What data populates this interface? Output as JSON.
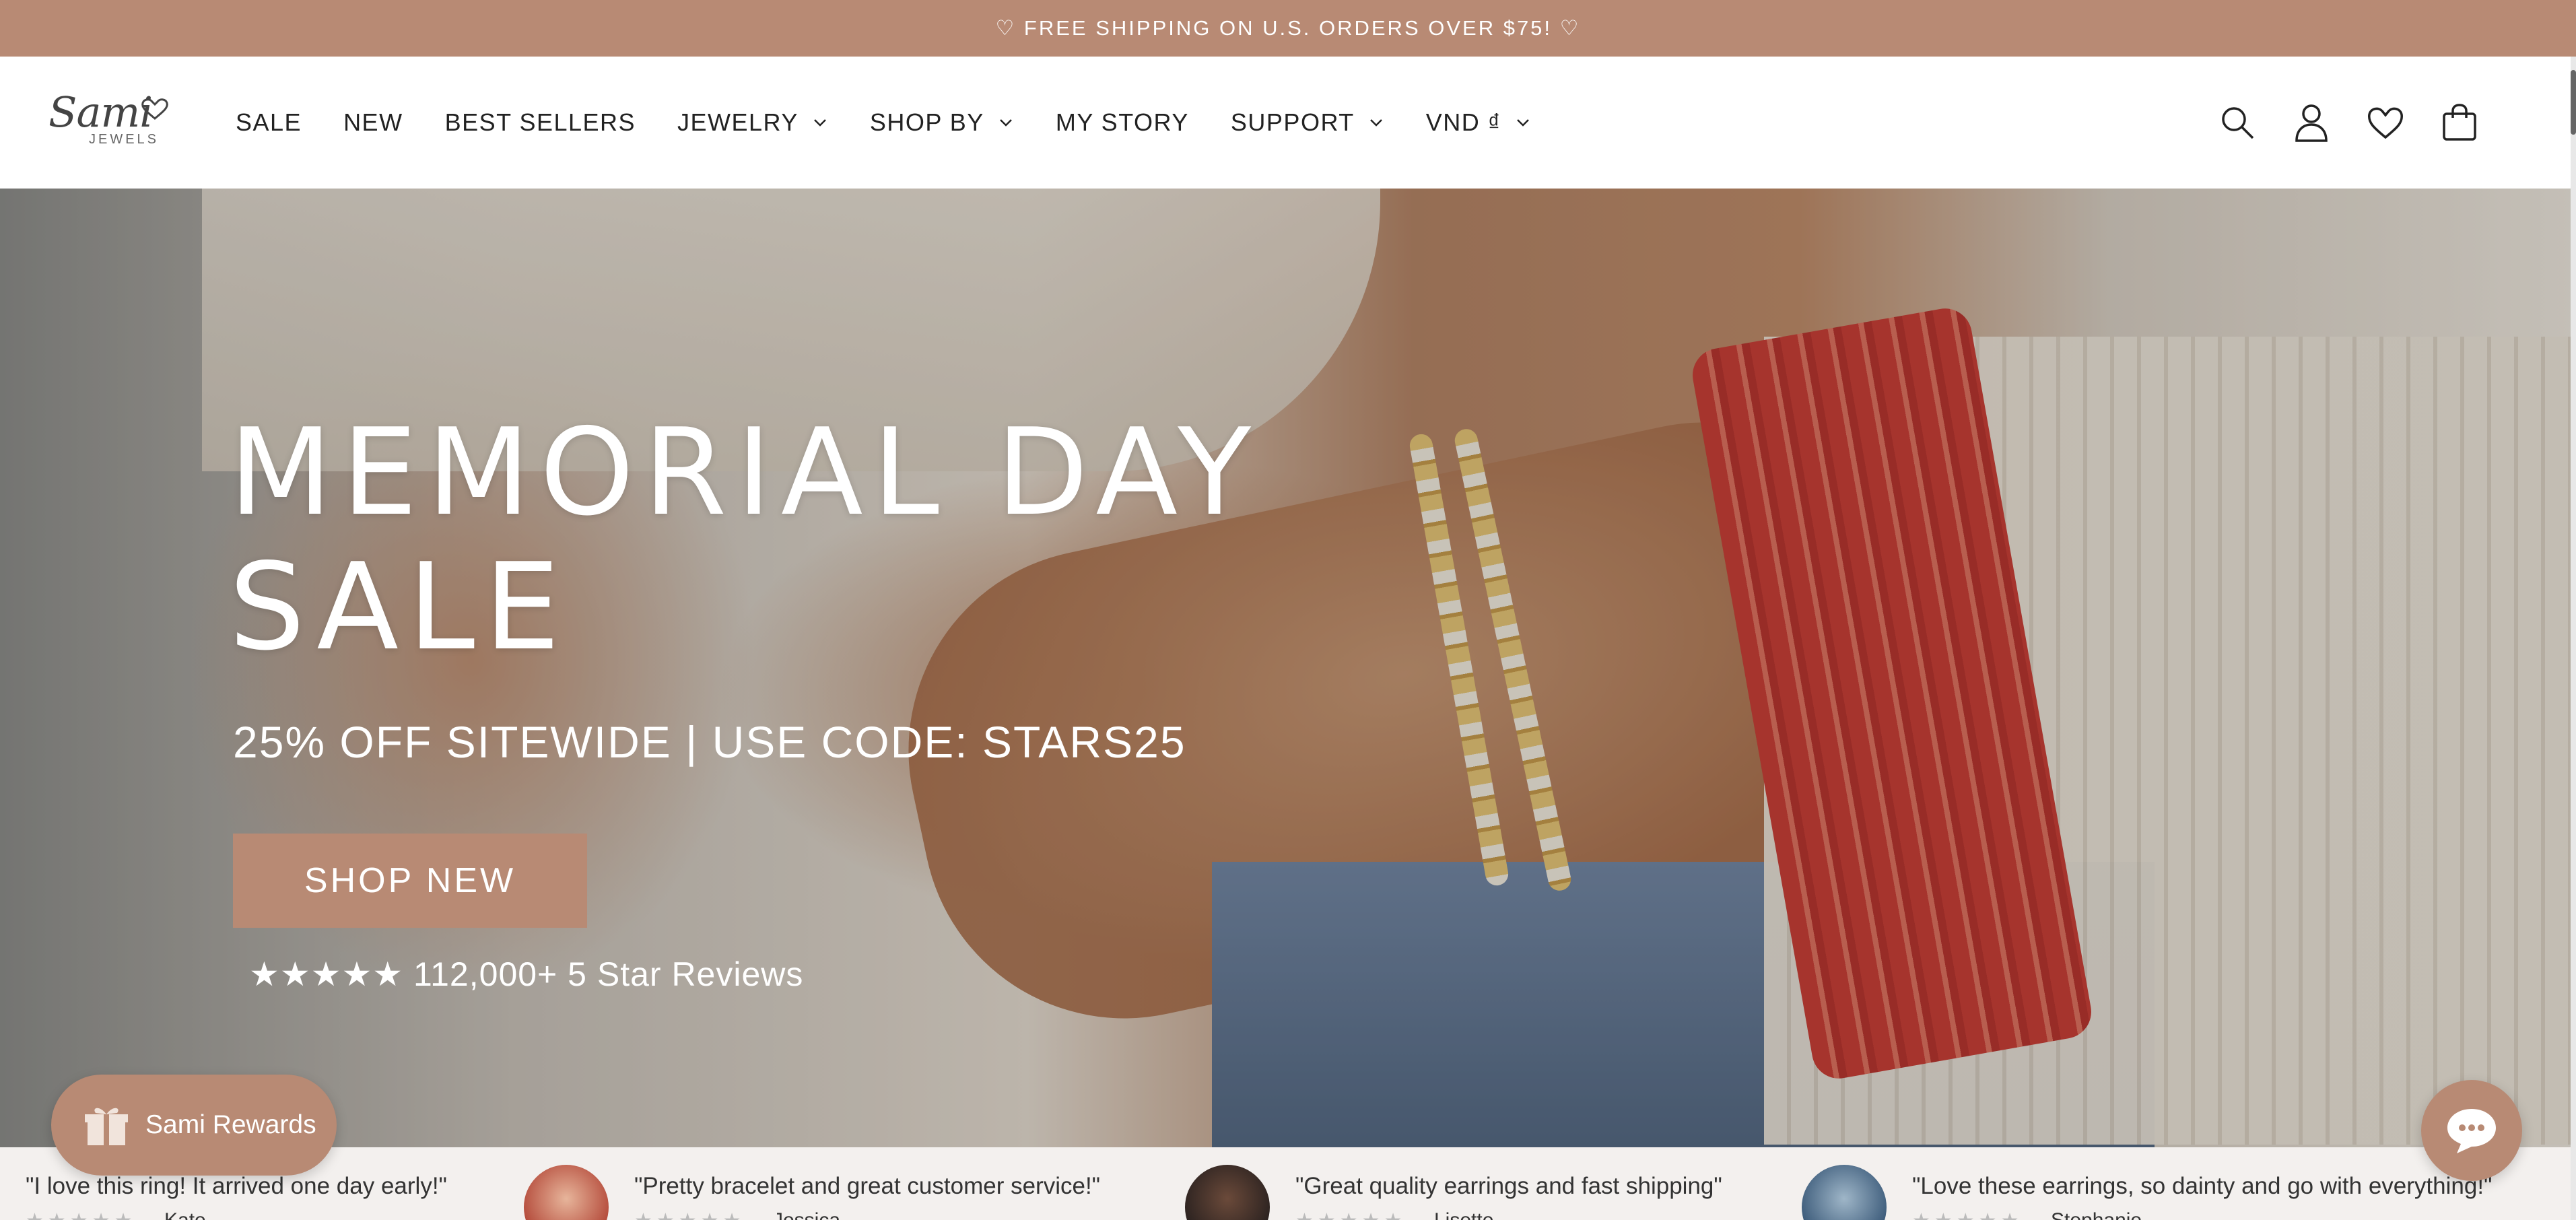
{
  "announcement": {
    "text": "♡ FREE SHIPPING ON U.S. ORDERS OVER $75! ♡"
  },
  "logo": {
    "script": "Sami",
    "sub": "JEWELS"
  },
  "nav": {
    "items": [
      {
        "label": "SALE",
        "dropdown": false
      },
      {
        "label": "NEW",
        "dropdown": false
      },
      {
        "label": "BEST SELLERS",
        "dropdown": false
      },
      {
        "label": "JEWELRY",
        "dropdown": true
      },
      {
        "label": "SHOP BY",
        "dropdown": true
      },
      {
        "label": "MY STORY",
        "dropdown": false
      },
      {
        "label": "SUPPORT",
        "dropdown": true
      },
      {
        "label": "VND ₫",
        "dropdown": true
      }
    ]
  },
  "header_icons": [
    "search-icon",
    "account-icon",
    "wishlist-heart-icon",
    "cart-bag-icon"
  ],
  "hero": {
    "title_line1": "MEMORIAL DAY",
    "title_line2": "SALE",
    "subtitle": "25% OFF SITEWIDE | USE CODE: STARS25",
    "button_label": "SHOP NEW",
    "reviews_stars": "★★★★★",
    "reviews_text": "112,000+ 5 Star Reviews"
  },
  "rewards": {
    "label": "Sami Rewards"
  },
  "reviews": [
    {
      "quote": "\"I love this ring! It arrived one day early!\"",
      "stars": "★★★★★",
      "name": "Kate"
    },
    {
      "quote": "\"Pretty bracelet and great customer service!\"",
      "stars": "★★★★★",
      "name": "Jessica"
    },
    {
      "quote": "\"Great quality earrings and fast shipping\"",
      "stars": "★★★★★",
      "name": "Lisette"
    },
    {
      "quote": "\"Love these earrings, so dainty and go with everything!\"",
      "stars": "★★★★★",
      "name": "Stephanie"
    }
  ],
  "colors": {
    "accent": "#b88a74",
    "strip_bg": "#f3f0ee",
    "text": "#222222"
  }
}
